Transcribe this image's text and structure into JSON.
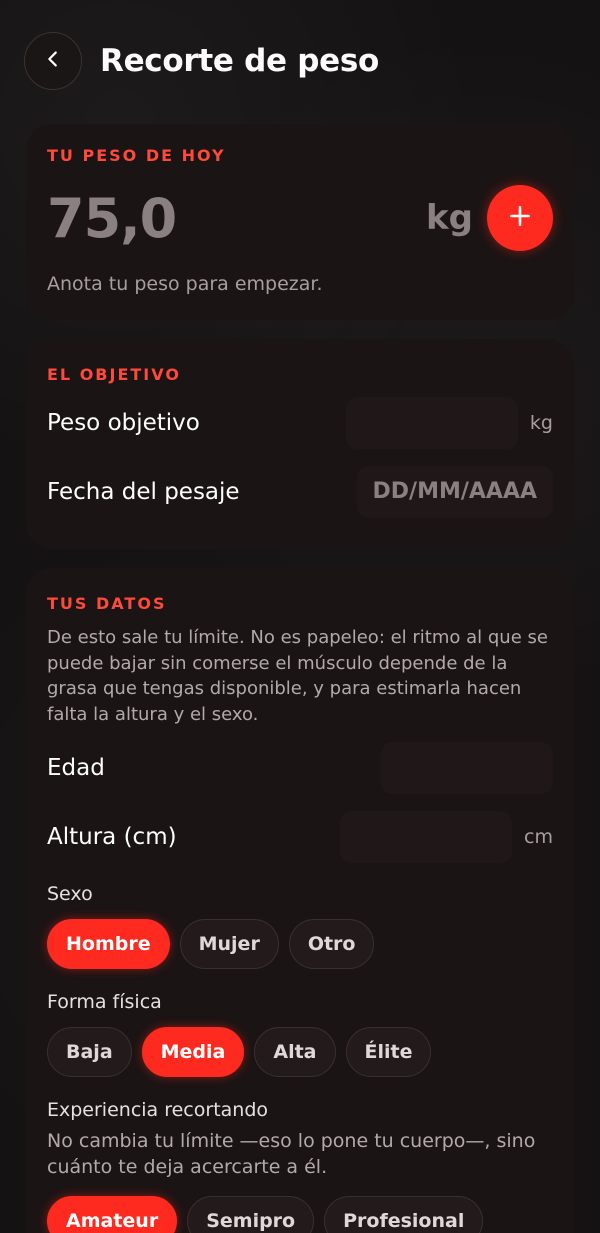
{
  "header": {
    "title": "Recorte de peso",
    "back_icon": "chevron-left-icon"
  },
  "today": {
    "label": "TU PESO DE HOY",
    "value": "75,0",
    "unit": "kg",
    "add_icon": "plus-icon",
    "helper": "Anota tu peso para empezar."
  },
  "goal": {
    "label": "EL OBJETIVO",
    "target_weight_label": "Peso objetivo",
    "target_weight_value": "",
    "target_weight_unit": "kg",
    "date_label": "Fecha del pesaje",
    "date_placeholder": "DD/MM/AAAA"
  },
  "data": {
    "label": "TUS DATOS",
    "description": "De esto sale tu límite. No es papeleo: el ritmo al que se puede bajar sin comerse el músculo depende de la grasa que tengas disponible, y para estimarla hacen falta la altura y el sexo.",
    "age_label": "Edad",
    "age_value": "",
    "height_label": "Altura (cm)",
    "height_value": "",
    "height_unit": "cm",
    "sex_label": "Sexo",
    "sex_options": [
      "Hombre",
      "Mujer",
      "Otro"
    ],
    "sex_selected": "Hombre",
    "fitness_label": "Forma física",
    "fitness_options": [
      "Baja",
      "Media",
      "Alta",
      "Élite"
    ],
    "fitness_selected": "Media",
    "experience_label": "Experiencia recortando",
    "experience_description": "No cambia tu límite —eso lo pone tu cuerpo—, sino cuánto te deja acercarte a él.",
    "experience_options": [
      "Amateur",
      "Semipro",
      "Profesional"
    ],
    "experience_selected": "Amateur"
  },
  "colors": {
    "accent": "#ff2a1f",
    "section_label": "#ff4a3a",
    "card": "#1b1414"
  }
}
